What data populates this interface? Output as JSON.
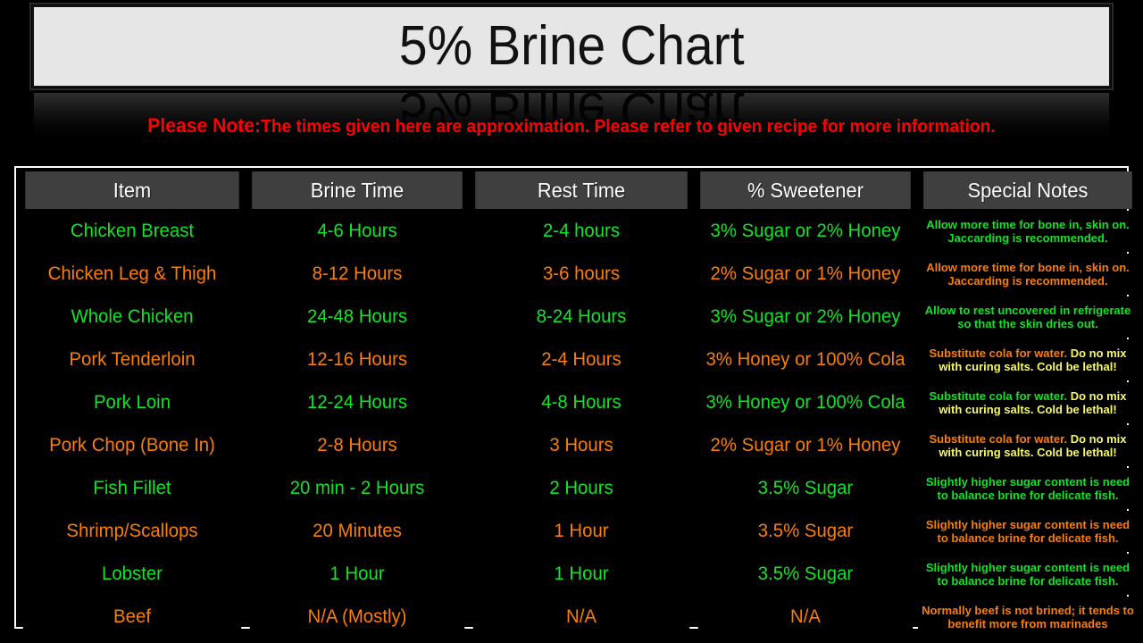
{
  "header": {
    "title": "5% Brine Chart",
    "note_lead": "Please Note:",
    "note_body": "The times given here are approximation. Please refer to given recipe for more information."
  },
  "colors": {
    "green": "#13e326",
    "orange": "#f97d0a",
    "warn_yellow": "#f7f76a",
    "note_red": "#ff0000",
    "header_bg": "#3f3f3f",
    "title_bg": "#e6e6e6",
    "page_bg": "#000000"
  },
  "chart_data": {
    "type": "table",
    "title": "5% Brine Chart",
    "columns": [
      "Item",
      "Brine Time",
      "Rest Time",
      "% Sweetener",
      "Special Notes"
    ],
    "rows": [
      {
        "item": "Chicken Breast",
        "brine_time": "4-6 Hours",
        "rest_time": "2-4 hours",
        "sweetener": "3% Sugar or 2% Honey",
        "note_main": "Allow more time for bone in, skin on. Jaccarding is recommended.",
        "note_warn": "",
        "color": "green"
      },
      {
        "item": "Chicken Leg & Thigh",
        "brine_time": "8-12 Hours",
        "rest_time": "3-6 hours",
        "sweetener": "2% Sugar or 1% Honey",
        "note_main": "Allow more time for bone in, skin on. Jaccarding is recommended.",
        "note_warn": "",
        "color": "orange"
      },
      {
        "item": "Whole Chicken",
        "brine_time": "24-48 Hours",
        "rest_time": "8-24 Hours",
        "sweetener": "3% Sugar or 2% Honey",
        "note_main": "Allow to rest uncovered in refrigerate so that the skin dries out.",
        "note_warn": "",
        "color": "green"
      },
      {
        "item": "Pork Tenderloin",
        "brine_time": "12-16 Hours",
        "rest_time": "2-4 Hours",
        "sweetener": "3% Honey or 100% Cola",
        "note_main": "Substitute cola for water.",
        "note_warn": "Do no mix with curing salts. Cold be lethal!",
        "color": "orange"
      },
      {
        "item": "Pork Loin",
        "brine_time": "12-24 Hours",
        "rest_time": "4-8 Hours",
        "sweetener": "3% Honey or 100% Cola",
        "note_main": "Substitute cola for water.",
        "note_warn": "Do no mix with curing salts. Cold be lethal!",
        "color": "green"
      },
      {
        "item": "Pork Chop (Bone In)",
        "brine_time": "2-8 Hours",
        "rest_time": "3 Hours",
        "sweetener": "2% Sugar or 1% Honey",
        "note_main": "Substitute cola for water.",
        "note_warn": "Do no mix with curing salts. Cold be lethal!",
        "color": "orange"
      },
      {
        "item": "Fish Fillet",
        "brine_time": "20 min - 2 Hours",
        "rest_time": "2 Hours",
        "sweetener": "3.5% Sugar",
        "note_main": "Slightly higher sugar content is need to balance brine for delicate fish.",
        "note_warn": "",
        "color": "green"
      },
      {
        "item": "Shrimp/Scallops",
        "brine_time": "20 Minutes",
        "rest_time": "1 Hour",
        "sweetener": "3.5% Sugar",
        "note_main": "Slightly higher sugar content is need to balance brine for delicate fish.",
        "note_warn": "",
        "color": "orange"
      },
      {
        "item": "Lobster",
        "brine_time": "1 Hour",
        "rest_time": "1 Hour",
        "sweetener": "3.5% Sugar",
        "note_main": "Slightly higher sugar content is need to balance brine for delicate fish.",
        "note_warn": "",
        "color": "green"
      },
      {
        "item": "Beef",
        "brine_time": "N/A (Mostly)",
        "rest_time": "N/A",
        "sweetener": "N/A",
        "note_main": "Normally beef is not brined; it tends to benefit more from marinades",
        "note_warn": "",
        "color": "orange"
      }
    ]
  }
}
